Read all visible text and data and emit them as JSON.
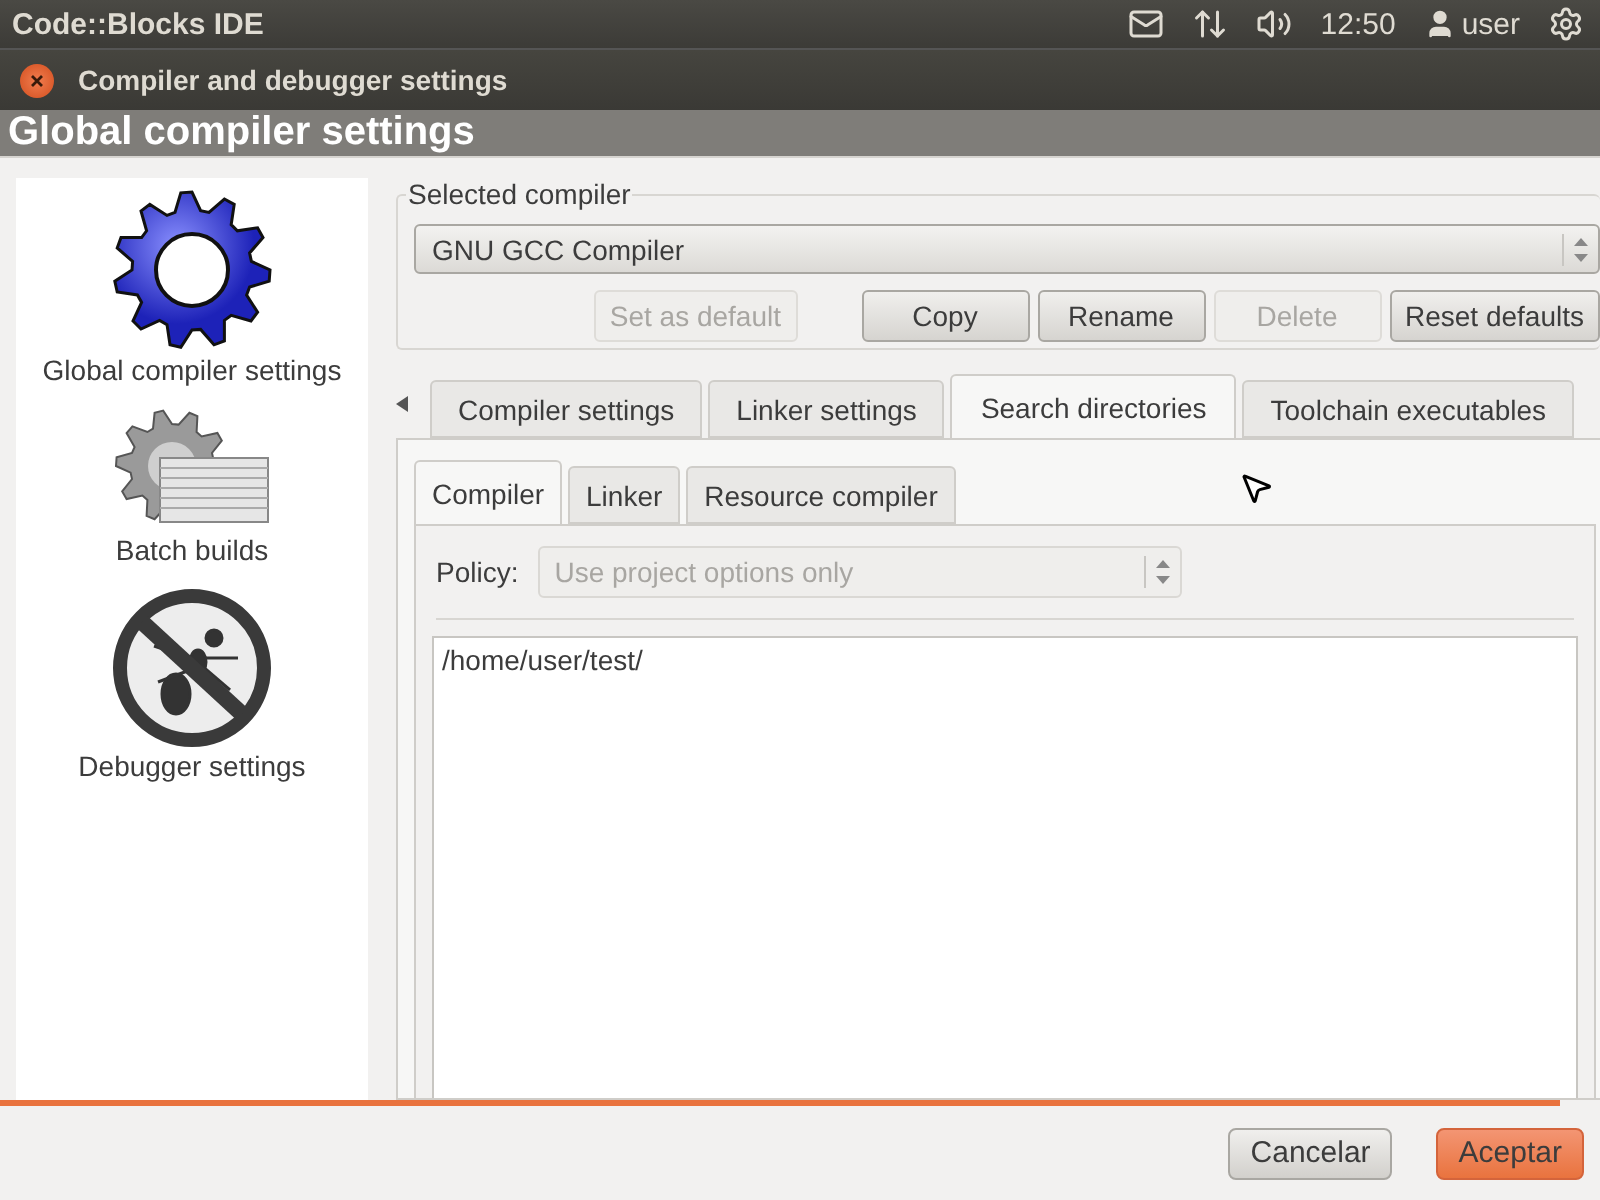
{
  "top_panel": {
    "app_title": "Code::Blocks IDE",
    "clock": "12:50",
    "user": "user"
  },
  "dialog": {
    "title": "Compiler and debugger settings"
  },
  "header": "Global compiler settings",
  "sidebar": {
    "items": [
      {
        "label": "Global compiler settings",
        "kind": "gear"
      },
      {
        "label": "Batch builds",
        "kind": "batch"
      },
      {
        "label": "Debugger settings",
        "kind": "debugger"
      }
    ]
  },
  "compiler_group": {
    "label": "Selected compiler",
    "value": "GNU GCC Compiler",
    "buttons": [
      {
        "label": "Set as default",
        "disabled": true
      },
      {
        "label": "Copy",
        "disabled": false
      },
      {
        "label": "Rename",
        "disabled": false
      },
      {
        "label": "Delete",
        "disabled": true
      },
      {
        "label": "Reset defaults",
        "disabled": false
      }
    ]
  },
  "tabs": [
    {
      "label": "Compiler settings",
      "selected": false
    },
    {
      "label": "Linker settings",
      "selected": false
    },
    {
      "label": "Search directories",
      "selected": true
    },
    {
      "label": "Toolchain executables",
      "selected": false
    }
  ],
  "subtabs": [
    {
      "label": "Compiler",
      "selected": true
    },
    {
      "label": "Linker",
      "selected": false
    },
    {
      "label": "Resource compiler",
      "selected": false
    }
  ],
  "policy": {
    "label": "Policy:",
    "value": "Use project options only",
    "disabled": true
  },
  "directories": [
    "/home/user/test/"
  ],
  "buttons": [
    {
      "label": "Cancelar",
      "kind": "secondary"
    },
    {
      "label": "Aceptar",
      "kind": "primary"
    }
  ]
}
